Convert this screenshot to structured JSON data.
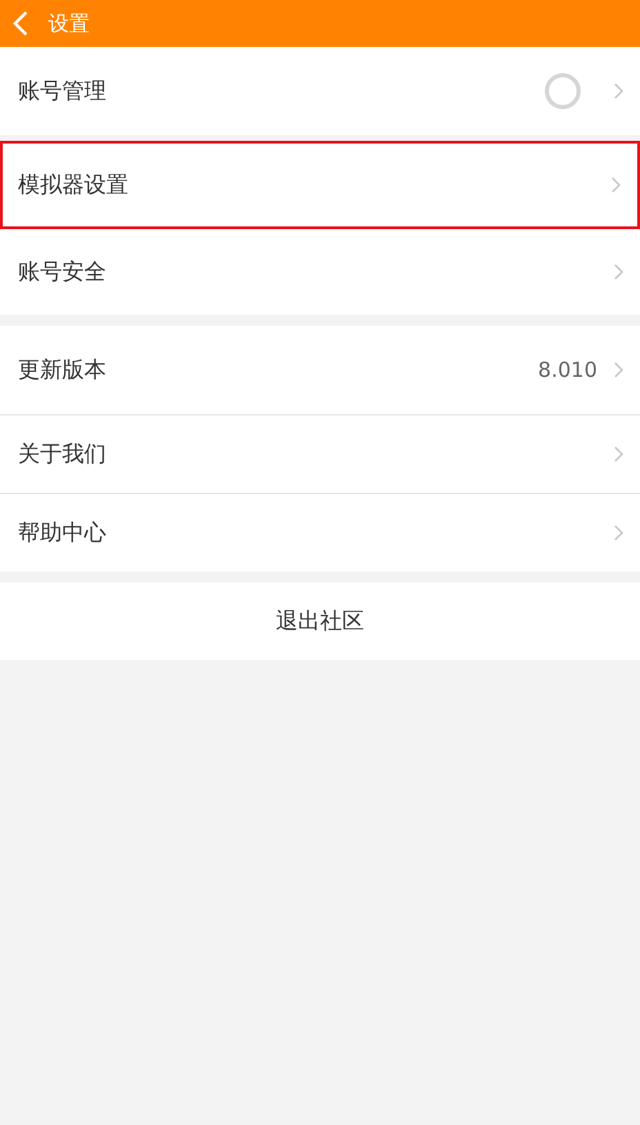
{
  "header": {
    "title": "设置"
  },
  "groups": [
    {
      "items": [
        {
          "label": "账号管理",
          "avatar": true,
          "highlighted": false
        },
        {
          "label": "模拟器设置",
          "avatar": false,
          "highlighted": true
        },
        {
          "label": "账号安全",
          "avatar": false,
          "highlighted": false
        }
      ]
    },
    {
      "items": [
        {
          "label": "更新版本",
          "value": "8.010",
          "avatar": false,
          "highlighted": false
        },
        {
          "label": "关于我们",
          "avatar": false,
          "highlighted": false
        },
        {
          "label": "帮助中心",
          "avatar": false,
          "highlighted": false
        }
      ]
    }
  ],
  "logout": {
    "label": "退出社区"
  }
}
